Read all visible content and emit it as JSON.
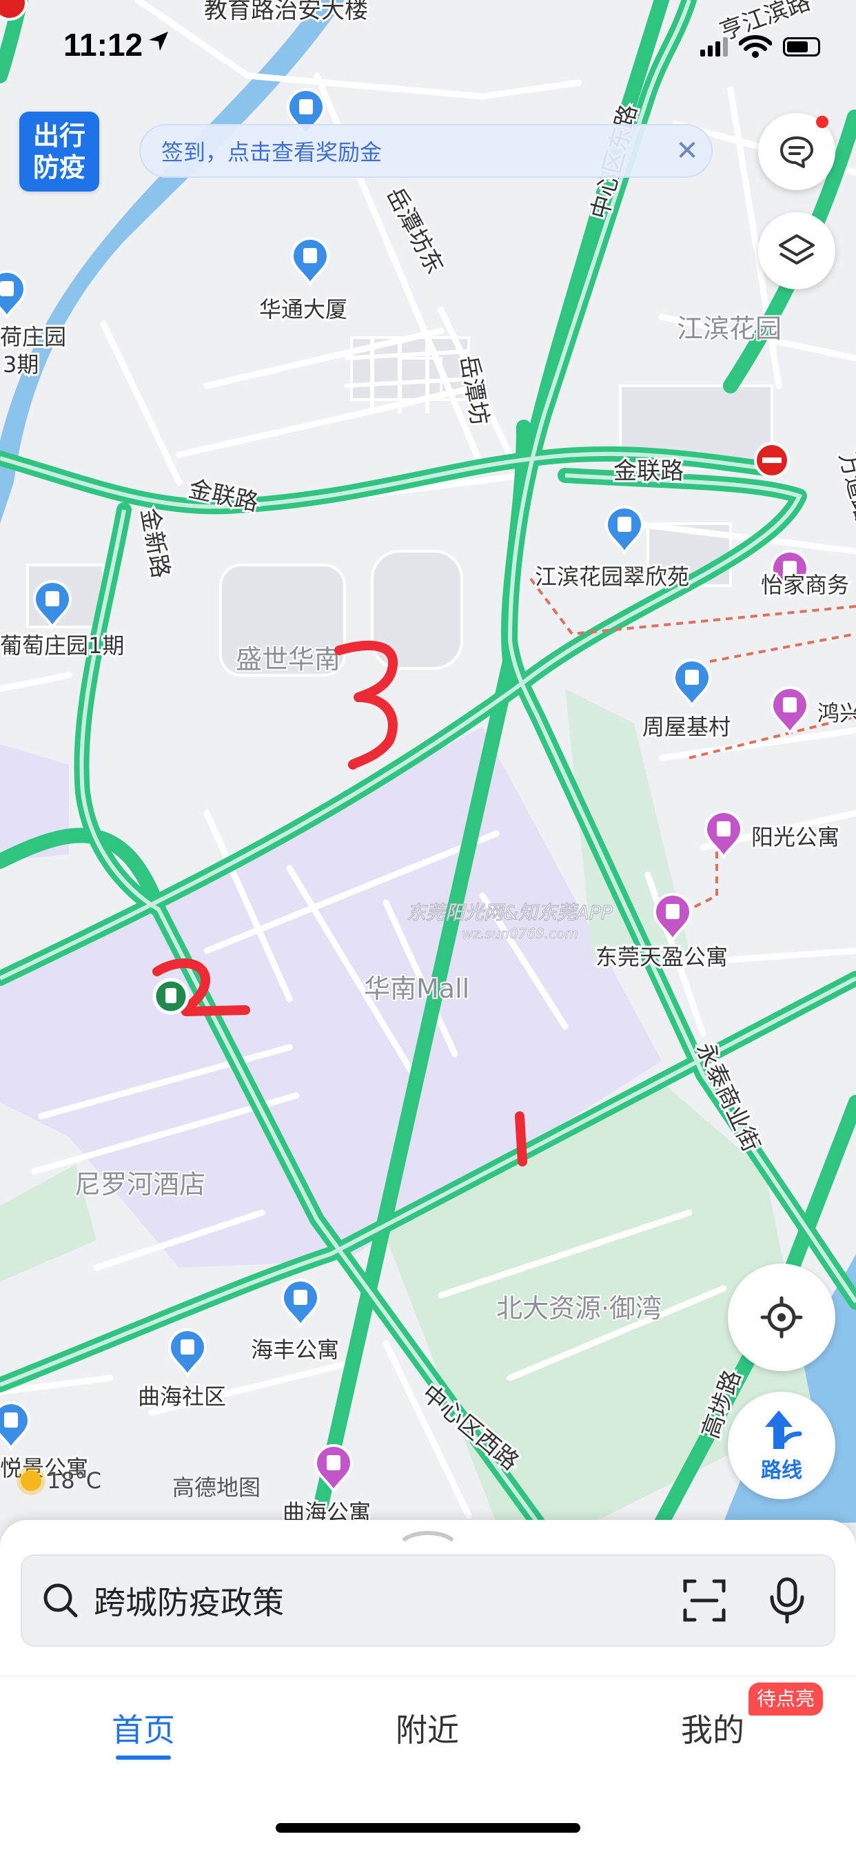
{
  "status_bar": {
    "time": "11:12"
  },
  "covid_badge": {
    "line1": "出行",
    "line2": "防疫"
  },
  "signin_banner": {
    "text": "签到，点击查看奖励金",
    "close": "✕"
  },
  "map": {
    "road_labels": [
      "教育路治安大楼",
      "岳潭坊东",
      "中心区东路",
      "岳潭坊",
      "金联路",
      "金联路",
      "金新路",
      "万道路",
      "永泰商业街",
      "中心区西路",
      "高埗路",
      "亨江滨路"
    ],
    "area_labels": [
      "江滨花园",
      "盛世华南",
      "华南Mall",
      "北大资源·御湾",
      "尼罗河酒店"
    ],
    "poi_labels": [
      "华通大厦",
      "江滨花园翠欣苑",
      "怡家商务",
      "周屋基村",
      "鸿兴",
      "阳光公寓",
      "东莞天盈公寓",
      "海丰公寓",
      "曲海社区",
      "悦景公寓",
      "曲海公寓",
      "荷庄园",
      "3期",
      "葡萄庄园1期"
    ],
    "annotations": [
      "1",
      "2",
      "3"
    ],
    "watermark": "东莞阳光网&知东莞APP",
    "watermark_sub": "wz.sun0769.com",
    "map_logo": "高德地图"
  },
  "weather": {
    "temperature": "18°C"
  },
  "route_button": {
    "label": "路线"
  },
  "search": {
    "placeholder": "跨城防疫政策"
  },
  "tabs": [
    {
      "label": "首页",
      "active": true
    },
    {
      "label": "附近",
      "active": false
    },
    {
      "label": "我的",
      "active": false
    }
  ],
  "badge": {
    "pending": "待点亮"
  },
  "colors": {
    "accent": "#1e73e8",
    "road_green": "#2fc480",
    "mall": "#e3def5",
    "park": "#d6ecdb",
    "annotation_red": "#ee2b35"
  }
}
